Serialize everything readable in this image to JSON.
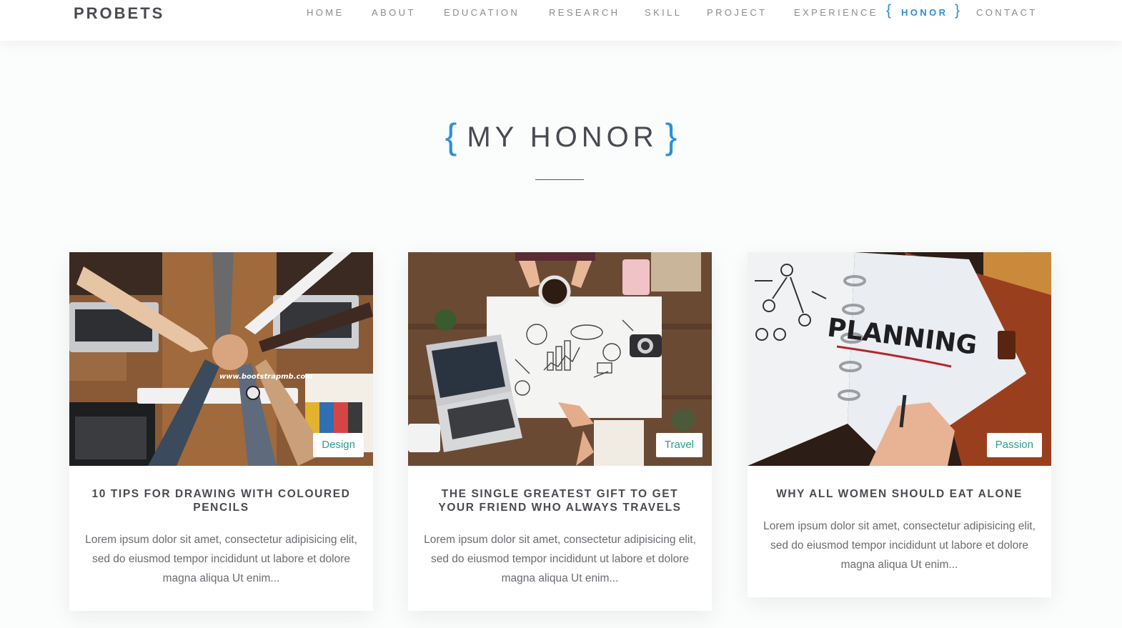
{
  "navbar": {
    "brand": "PROBETS",
    "items": [
      {
        "label": "HOME"
      },
      {
        "label": "ABOUT"
      },
      {
        "label": "EDUCATION"
      },
      {
        "label": "RESEARCH"
      },
      {
        "label": "SKILL"
      },
      {
        "label": "PROJECT"
      },
      {
        "label": "EXPERIENCE"
      },
      {
        "label": "HONOR",
        "active": true
      },
      {
        "label": "CONTACT"
      }
    ],
    "active_brace_left": "{",
    "active_brace_right": "}"
  },
  "section": {
    "brace_left": "{",
    "title": "MY HONOR",
    "brace_right": "}"
  },
  "colors": {
    "accent": "#2b8fdc",
    "tag_text": "#2a9d8f"
  },
  "cards": [
    {
      "image": "team-fist-bump-photo",
      "watermark": "www.bootstrapmb.com",
      "tag": "Design",
      "title": "10 TIPS FOR DRAWING WITH COLOURED PENCILS",
      "text": "Lorem ipsum dolor sit amet, consectetur adipisicing elit, sed do eiusmod tempor incididunt ut labore et dolore magna aliqua Ut enim..."
    },
    {
      "image": "business-sketch-desk-photo",
      "tag": "Travel",
      "title": "THE SINGLE GREATEST GIFT TO GET YOUR FRIEND WHO ALWAYS TRAVELS",
      "text": "Lorem ipsum dolor sit amet, consectetur adipisicing elit, sed do eiusmod tempor incididunt ut labore et dolore magna aliqua Ut enim..."
    },
    {
      "image": "planning-notebook-photo",
      "image_text": "PLANNING",
      "tag": "Passion",
      "title": "WHY ALL WOMEN SHOULD EAT ALONE",
      "text": "Lorem ipsum dolor sit amet, consectetur adipisicing elit, sed do eiusmod tempor incididunt ut labore et dolore magna aliqua Ut enim..."
    }
  ]
}
